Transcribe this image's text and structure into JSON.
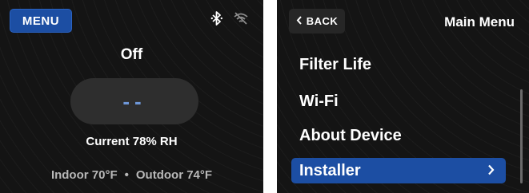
{
  "left_screen": {
    "menu_label": "MENU",
    "status_icons": [
      "bluetooth-icon",
      "wifi-off-icon"
    ],
    "mode": "Off",
    "setpoint": "--",
    "humidity": "Current 78% RH",
    "indoor": "Indoor 70°F",
    "separator": "•",
    "outdoor": "Outdoor 74°F"
  },
  "right_screen": {
    "back_label": "BACK",
    "title": "Main Menu",
    "items": [
      {
        "label": "Filter Life"
      },
      {
        "label": "Wi-Fi"
      },
      {
        "label": "About Device"
      },
      {
        "label": "Installer",
        "selected": true
      }
    ]
  },
  "colors": {
    "accent": "#1c4ea3",
    "setpoint": "#6e97d8",
    "background": "#141414"
  }
}
